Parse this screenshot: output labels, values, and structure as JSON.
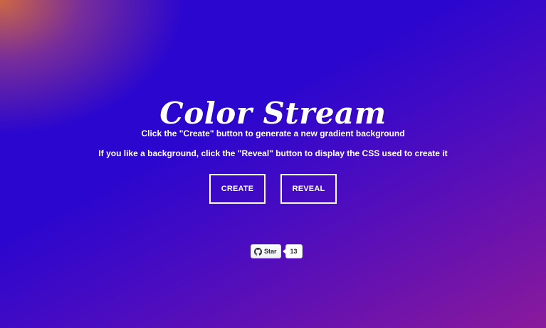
{
  "title": "Color Stream",
  "instructions": {
    "line1": "Click the \"Create\" button to generate a new gradient background",
    "line2": "If you like a background, click the \"Reveal\" button to display the CSS used to create it"
  },
  "buttons": {
    "create_label": "CREATE",
    "reveal_label": "REVEAL"
  },
  "github": {
    "star_label": "Star",
    "star_count": "13",
    "icon": "github-icon"
  },
  "colors": {
    "background_primary": "#2a06cf",
    "background_secondary": "#8a1a9a",
    "corner_accent": "#d66c3c",
    "text": "#ffffff"
  }
}
